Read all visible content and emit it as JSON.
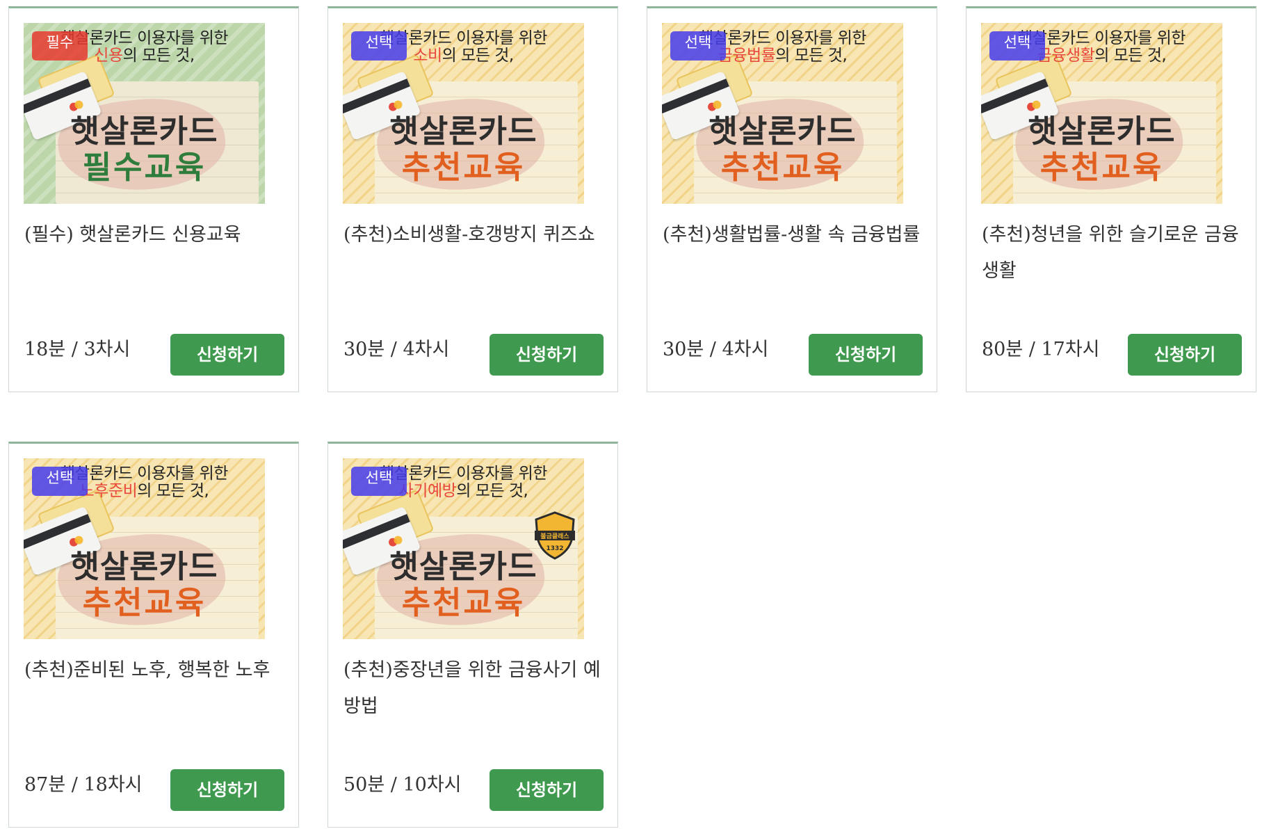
{
  "courses": [
    {
      "badge": "필수",
      "badge_color": "#e83a30",
      "thumb_line1": "햇살론카드 이용자를 위한",
      "thumb_highlight": "신용",
      "thumb_suffix": "의 모든 것,",
      "thumb_title1": "햇살론카드",
      "thumb_title2": "필수교육",
      "title": "(필수) 햇살론카드 신용교육",
      "meta": "18분 / 3차시",
      "button": "신청하기"
    },
    {
      "badge": "선택",
      "badge_color": "#463ceb",
      "thumb_line1": "햇살론카드 이용자를 위한",
      "thumb_highlight": "소비",
      "thumb_suffix": "의 모든 것,",
      "thumb_title1": "햇살론카드",
      "thumb_title2": "추천교육",
      "title": "(추천)소비생활-호갱방지 퀴즈쇼",
      "meta": "30분 / 4차시",
      "button": "신청하기"
    },
    {
      "badge": "선택",
      "badge_color": "#463ceb",
      "thumb_line1": "햇살론카드 이용자를 위한",
      "thumb_highlight": "금융법률",
      "thumb_suffix": "의 모든 것,",
      "thumb_title1": "햇살론카드",
      "thumb_title2": "추천교육",
      "title": "(추천)생활법률-생활 속 금융법률",
      "meta": "30분 / 4차시",
      "button": "신청하기"
    },
    {
      "badge": "선택",
      "badge_color": "#463ceb",
      "thumb_line1": "햇살론카드 이용자를 위한",
      "thumb_highlight": "금융생활",
      "thumb_suffix": "의 모든 것,",
      "thumb_title1": "햇살론카드",
      "thumb_title2": "추천교육",
      "title": "(추천)청년을 위한 슬기로운 금융생활",
      "meta": "80분 / 17차시",
      "button": "신청하기"
    },
    {
      "badge": "선택",
      "badge_color": "#463ceb",
      "thumb_line1": "햇살론카드 이용자를 위한",
      "thumb_highlight": "노후준비",
      "thumb_suffix": "의 모든 것,",
      "thumb_title1": "햇살론카드",
      "thumb_title2": "추천교육",
      "title": "(추천)준비된 노후, 행복한 노후",
      "meta": "87분 / 18차시",
      "button": "신청하기"
    },
    {
      "badge": "선택",
      "badge_color": "#463ceb",
      "thumb_line1": "햇살론카드 이용자를 위한",
      "thumb_highlight": "사기예방",
      "thumb_suffix": "의 모든 것,",
      "thumb_title1": "햇살론카드",
      "thumb_title2": "추천교육",
      "shield_text": "불금클래스",
      "shield_number": "1332",
      "title": "(추천)중장년을 위한 금융사기 예방법",
      "meta": "50분 / 10차시",
      "button": "신청하기"
    }
  ],
  "colors": {
    "button_bg": "#3f9a4f",
    "card_top_border": "#8fb59a",
    "required_title": "#2f7d3c",
    "recommended_title": "#e2601f",
    "highlight": "#e8483c"
  }
}
